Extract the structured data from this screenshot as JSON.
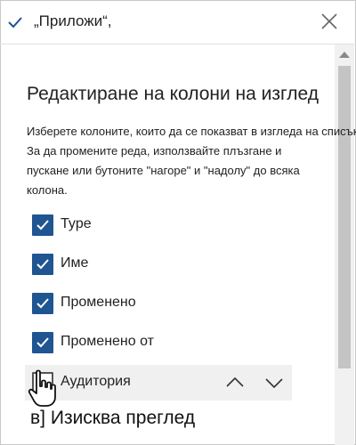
{
  "header": {
    "title": "„Приложи“,",
    "check_icon": "checkmark-icon",
    "close_icon": "close-icon"
  },
  "panel": {
    "title": "Редактиране на колони на изглед",
    "instructions": [
      "Изберете колоните, които да се показват в изгледа на списък.",
      "За да промените реда, използвайте плъзгане и",
      "пускане или бутоните \"нагоре\" и \"надолу\" до всяка",
      "колона."
    ]
  },
  "columns": [
    {
      "label": "Type",
      "checked": true
    },
    {
      "label": "Име",
      "checked": true
    },
    {
      "label": "Променено",
      "checked": true
    },
    {
      "label": "Променено от",
      "checked": true
    },
    {
      "label": "Аудитория",
      "checked": false
    }
  ],
  "badge": {
    "letter": "в]",
    "text": "Изисква преглед"
  },
  "colors": {
    "accent": "#1f5591",
    "checkbox_checked": "#1f5591",
    "row_highlight": "#f0f0f0"
  }
}
